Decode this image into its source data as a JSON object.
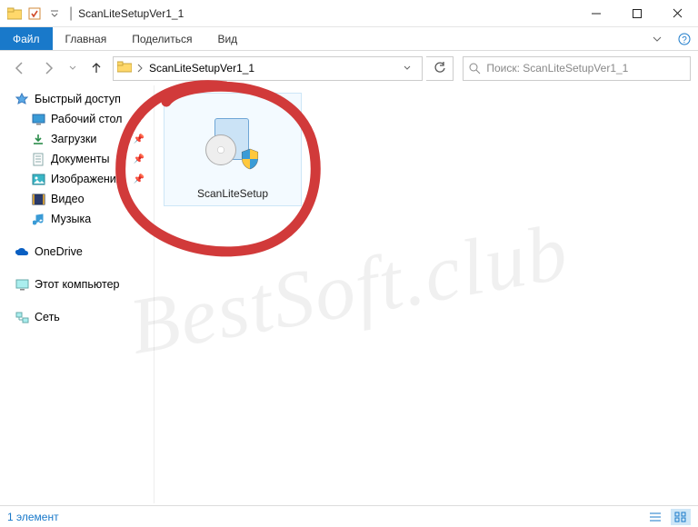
{
  "window": {
    "title": "ScanLiteSetupVer1_1"
  },
  "ribbon": {
    "file": "Файл",
    "tabs": [
      "Главная",
      "Поделиться",
      "Вид"
    ]
  },
  "address": {
    "current": "ScanLiteSetupVer1_1"
  },
  "search": {
    "placeholder": "Поиск: ScanLiteSetupVer1_1"
  },
  "sidebar": {
    "quick_access": "Быстрый доступ",
    "quick_items": [
      {
        "label": "Рабочий стол",
        "icon": "desktop",
        "pinned": true
      },
      {
        "label": "Загрузки",
        "icon": "downloads",
        "pinned": true
      },
      {
        "label": "Документы",
        "icon": "documents",
        "pinned": true
      },
      {
        "label": "Изображения",
        "icon": "pictures",
        "pinned": true
      },
      {
        "label": "Видео",
        "icon": "videos",
        "pinned": false
      },
      {
        "label": "Музыка",
        "icon": "music",
        "pinned": false
      }
    ],
    "onedrive": "OneDrive",
    "this_pc": "Этот компьютер",
    "network": "Сеть"
  },
  "content": {
    "file_name": "ScanLiteSetup"
  },
  "statusbar": {
    "count": "1 элемент"
  },
  "watermark": "BestSoft.club"
}
